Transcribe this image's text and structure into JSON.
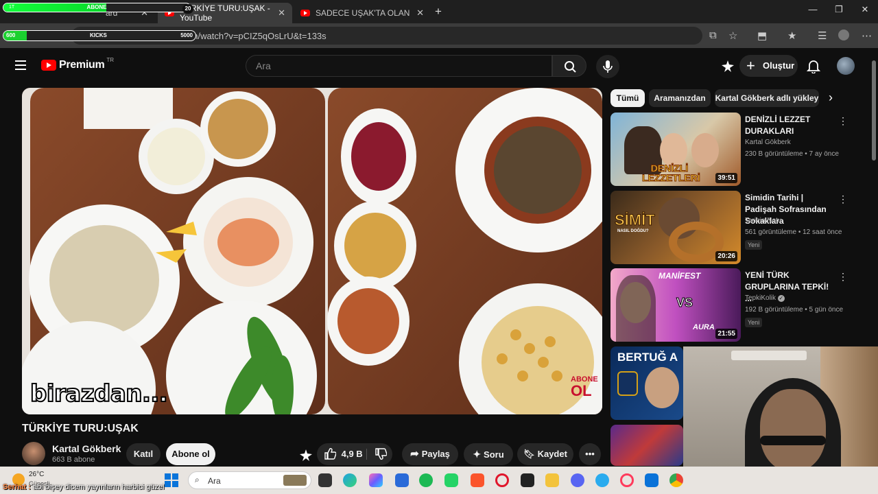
{
  "browser": {
    "tabs": [
      {
        "title": "ard"
      },
      {
        "title": "TÜRKİYE TURU:UŞAK - YouTube"
      },
      {
        "title": "SADECE UŞAK'TA OLAN YEMEK"
      }
    ],
    "new_tab": "+",
    "window_controls": {
      "minimize": "—",
      "restore": "❐",
      "close": "✕"
    },
    "url": "https://www.youtube.com/watch?v=pCIZ5qOsLrU&t=133s"
  },
  "stream_overlay": {
    "hp_bar": {
      "left_label": "1T",
      "label": "ABONE",
      "count": "20",
      "fill": 0.55
    },
    "kicks_bar": {
      "left_label": "600",
      "label": "KICKS",
      "right_label": "5000",
      "fill": 0.12
    },
    "chat": {
      "user": "Serhat :",
      "message": " abi bişey dicem yayınların harbici güzel"
    }
  },
  "youtube": {
    "logo_text": "Premium",
    "country": "TR",
    "search_placeholder": "Ara",
    "create_label": "Oluştur",
    "video": {
      "caption": "birazdan...",
      "badge_top": "ABONE",
      "badge_bottom": "OL",
      "title": "TÜRKİYE TURU:UŞAK",
      "channel": "Kartal Gökberk",
      "subscribers": "663 B abone",
      "join_label": "Katıl",
      "subscribe_label": "Abone ol",
      "likes": "4,9 B",
      "share_label": "Paylaş",
      "ask_label": "Soru",
      "save_label": "Kaydet"
    },
    "chips": [
      "Tümü",
      "Aramanızdan",
      "Kartal Gökberk adlı yükley"
    ],
    "recommendations": [
      {
        "title": "DENİZLİ LEZZET DURAKLARI",
        "channel": "Kartal Gökberk",
        "meta": "230 B görüntüleme • 7 ay önce",
        "duration": "39:51",
        "thumb_text": "DENİZLİ LEZZETLERİ",
        "badge": ""
      },
      {
        "title": "Simidin Tarihi | Padişah Sofrasından Sokaklara",
        "channel": "Tarihin Notu",
        "meta": "561 görüntüleme • 12 saat önce",
        "duration": "20:26",
        "thumb_text": "SİMİT",
        "thumb_sub": "NASIL DOĞDU?",
        "badge": "Yeni"
      },
      {
        "title": "YENİ TÜRK GRUPLARINA TEPKİ! ...",
        "channel": "TepkiKolik",
        "meta": "192 B görüntüleme • 5 gün önce",
        "duration": "21:55",
        "thumb_text": "MANİFEST",
        "thumb_sub": "VS",
        "thumb_sub2": "AURA",
        "badge": "Yeni"
      },
      {
        "thumb_text": "BERTUĞ A"
      }
    ]
  },
  "taskbar": {
    "temperature": "26°C",
    "weather": "Güneşli",
    "search_placeholder": "Ara"
  },
  "colors": {
    "youtube_red": "#ff0000",
    "bg": "#0f0f0f",
    "chip": "#272727"
  }
}
